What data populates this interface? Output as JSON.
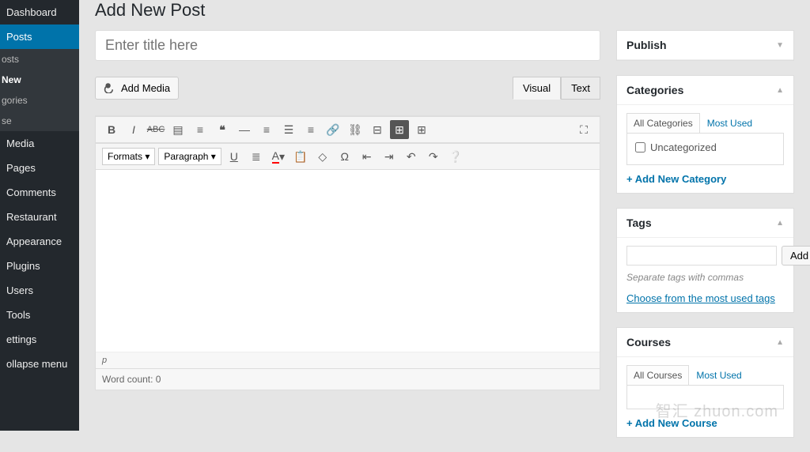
{
  "page_title": "Add New Post",
  "title_placeholder": "Enter title here",
  "sidebar": {
    "items": [
      {
        "label": "Dashboard",
        "active": false
      },
      {
        "label": "Posts",
        "active": true,
        "subs": [
          {
            "label": "osts",
            "selected": false
          },
          {
            "label": "New",
            "selected": true
          },
          {
            "label": "gories",
            "selected": false
          },
          {
            "label": "se",
            "selected": false
          }
        ]
      },
      {
        "label": "Media"
      },
      {
        "label": "Pages"
      },
      {
        "label": "Comments"
      },
      {
        "label": "Restaurant"
      },
      {
        "label": "Appearance"
      },
      {
        "label": "Plugins"
      },
      {
        "label": "Users"
      },
      {
        "label": "Tools"
      },
      {
        "label": "ettings"
      },
      {
        "label": "ollapse menu"
      }
    ]
  },
  "editor": {
    "add_media": "Add Media",
    "tab_visual": "Visual",
    "tab_text": "Text",
    "formats_label": "Formats",
    "paragraph_label": "Paragraph",
    "status_path": "p",
    "word_count": "Word count: 0"
  },
  "publish": {
    "title": "Publish"
  },
  "categories": {
    "title": "Categories",
    "tab_all": "All Categories",
    "tab_most": "Most Used",
    "uncategorized": "Uncategorized",
    "add_new": "+ Add New Category"
  },
  "tags": {
    "title": "Tags",
    "add_btn": "Add",
    "hint": "Separate tags with commas",
    "choose": "Choose from the most used tags"
  },
  "courses": {
    "title": "Courses",
    "tab_all": "All Courses",
    "tab_most": "Most Used",
    "add_new": "+ Add New Course"
  },
  "watermark": "智汇 zhuon.com"
}
